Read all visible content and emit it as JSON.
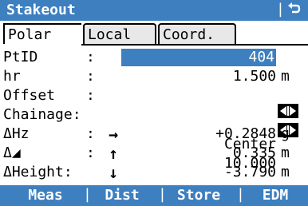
{
  "window": {
    "title": "Stakeout",
    "separator": "|",
    "back_glyph": "⮌"
  },
  "tabs": [
    {
      "label": "Polar",
      "active": true
    },
    {
      "label": "Local",
      "active": false
    },
    {
      "label": "Coord.",
      "active": false
    }
  ],
  "fields": {
    "ptid": {
      "label": "PtID",
      "colon": ":",
      "value": "404"
    },
    "hr": {
      "label": "hr",
      "colon": ":",
      "value": "1.500",
      "unit": "m"
    },
    "offset": {
      "label": "Offset",
      "colon": ":",
      "value": "Center"
    },
    "chainage": {
      "label": "Chainage:",
      "value": "10.000"
    },
    "dhz": {
      "label": "ΔHz",
      "colon": ":",
      "arrow": "→",
      "value": "+0.2848",
      "unit": "g"
    },
    "ddist": {
      "label": "Δ◢",
      "colon": ":",
      "arrow": "↑",
      "value": "0.335",
      "unit": "m"
    },
    "dheight": {
      "label": "ΔHeight:",
      "arrow": "↓",
      "value": "-3.790",
      "unit": "m"
    }
  },
  "softkeys": {
    "f1": "Meas",
    "f2": "Dist",
    "f3": "Store",
    "f4": "EDM",
    "separator": "|"
  },
  "colors": {
    "accent": "#3d7fbf",
    "background": "#ffffff",
    "text": "#000000"
  },
  "icons": [
    "back-arrow-icon",
    "toggle-left-right-icon",
    "arrow-right-icon",
    "arrow-up-icon",
    "arrow-down-icon"
  ]
}
